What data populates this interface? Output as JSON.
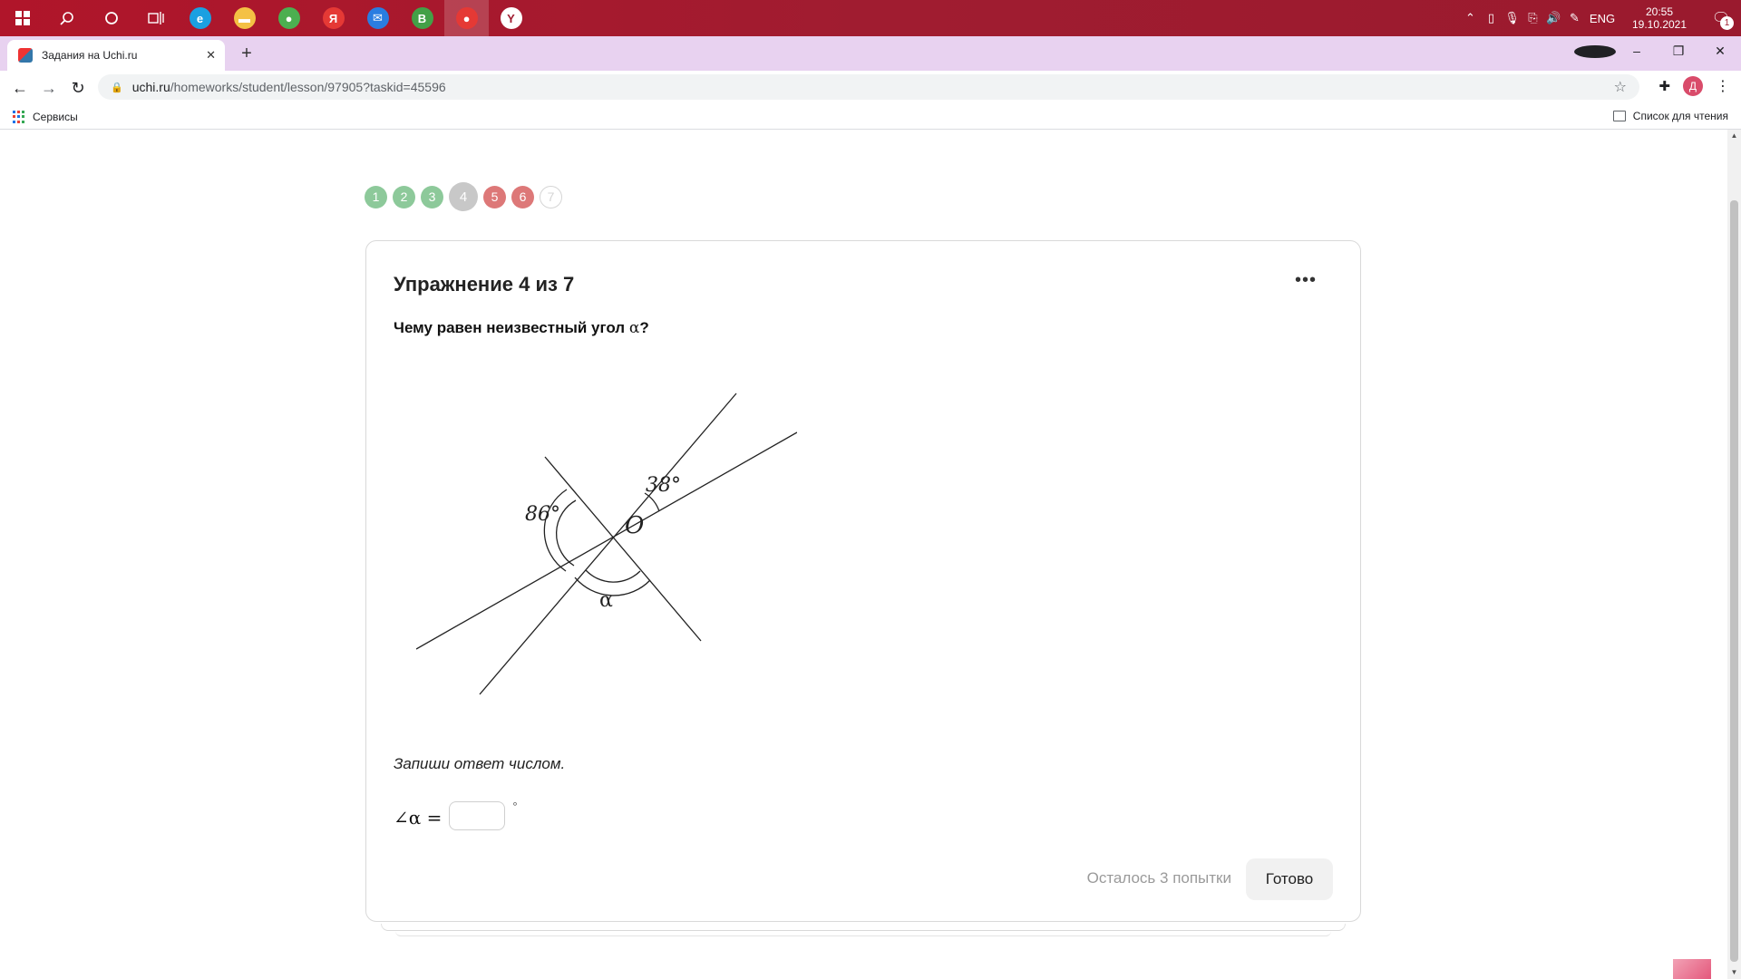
{
  "taskbar": {
    "clock_time": "20:55",
    "clock_date": "19.10.2021",
    "lang": "ENG",
    "notif_count": "1",
    "apps": [
      {
        "name": "edge",
        "color": "#1ba0e1",
        "glyph": "e"
      },
      {
        "name": "explorer",
        "color": "#f4c144",
        "glyph": "▬"
      },
      {
        "name": "chrome",
        "color": "#4caf50",
        "glyph": "●"
      },
      {
        "name": "yandex",
        "color": "#e53935",
        "glyph": "Я"
      },
      {
        "name": "mail",
        "color": "#2a7de1",
        "glyph": "✉"
      },
      {
        "name": "green-app",
        "color": "#43a047",
        "glyph": "В"
      },
      {
        "name": "chrome-profile",
        "color": "#e53935",
        "glyph": "●"
      },
      {
        "name": "yandex-browser",
        "color": "#ffffff",
        "glyph": "Y"
      }
    ]
  },
  "browser": {
    "tab_title": "Задания на Uchi.ru",
    "url_host": "uchi.ru",
    "url_path": "/homeworks/student/lesson/97905?taskid=45596",
    "bookmarks_label": "Сервисы",
    "reading_list": "Список для чтения",
    "profile_letter": "Д"
  },
  "progress": {
    "steps": [
      {
        "label": "1",
        "state": "ok"
      },
      {
        "label": "2",
        "state": "ok"
      },
      {
        "label": "3",
        "state": "ok"
      },
      {
        "label": "4",
        "state": "current"
      },
      {
        "label": "5",
        "state": "bad"
      },
      {
        "label": "6",
        "state": "bad"
      },
      {
        "label": "7",
        "state": "todo"
      }
    ]
  },
  "exercise": {
    "title": "Упражнение 4 из 7",
    "question_text": "Чему равен неизвестный угол ",
    "question_symbol": "α",
    "question_end": "?",
    "figure": {
      "angle_left": "86°",
      "angle_right": "38°",
      "center_label": "O",
      "unknown_label": "α"
    },
    "instruction": "Запиши ответ числом.",
    "answer_label": "∠α =",
    "answer_value": "",
    "degree_sign": "°",
    "attempts": "Осталось 3 попытки",
    "submit_label": "Готово"
  },
  "colors": {
    "step_ok": "#8dc99a",
    "step_bad": "#dd7878",
    "step_current": "#c8c8c8",
    "taskbar": "#a01c30",
    "tabbar": "#e8d2f0"
  }
}
